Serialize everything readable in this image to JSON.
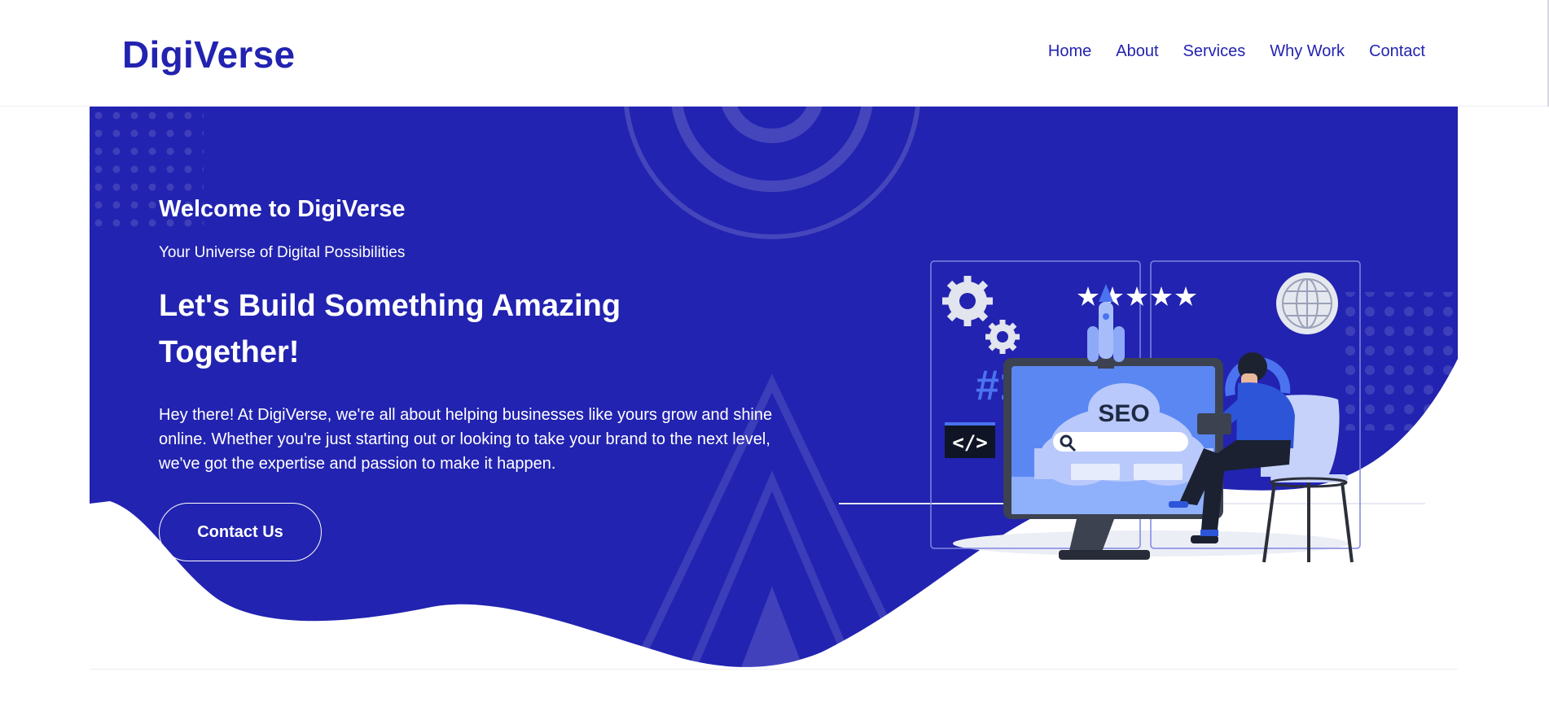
{
  "brand": {
    "name": "DigiVerse",
    "color": "#2223b0"
  },
  "nav": {
    "items": [
      {
        "label": "Home"
      },
      {
        "label": "About"
      },
      {
        "label": "Services"
      },
      {
        "label": "Why Work"
      },
      {
        "label": "Contact"
      }
    ]
  },
  "hero": {
    "welcome": "Welcome to DigiVerse",
    "tagline": "Your Universe of Digital Possibilities",
    "headline": "Let's Build Something Amazing Together!",
    "intro": "Hey there! At DigiVerse, we're all about helping businesses like yours grow and shine online. Whether you're just starting out or looking to take your brand to the next level, we've got the expertise and passion to make it happen.",
    "cta_label": "Contact Us",
    "background_color": "#2223b0"
  },
  "illustration": {
    "rank_badge": "#1",
    "seo_label": "SEO",
    "code_tag": "</>",
    "stars": 5
  }
}
